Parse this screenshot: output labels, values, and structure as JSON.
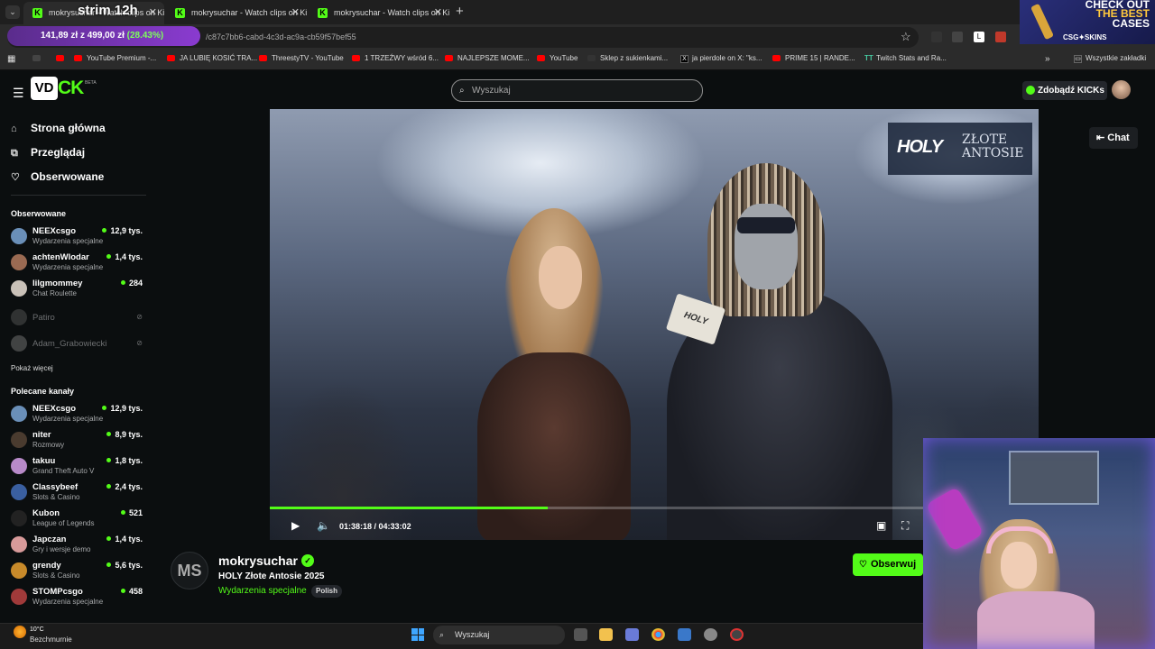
{
  "browser": {
    "tabs": [
      {
        "label": "mokrysuchar - Watch clips on Kick",
        "active": true
      },
      {
        "label": "mokrysuchar - Watch clips on Kick",
        "active": false
      },
      {
        "label": "mokrysuchar - Watch clips on Kick",
        "active": false
      }
    ],
    "url_tail": "/c87c7bb6-cabd-4c3d-ac9a-cb59f57bef55",
    "overlay_text": "strim 12h",
    "price_pill": {
      "price": "141,89 zł",
      "target": "z 499,00 zł",
      "pct": "(28.43%)"
    },
    "bookmarks": [
      {
        "label": "YouTube Premium -...",
        "icon": "youtube-icon"
      },
      {
        "label": "JA LUBIĘ KOSIĆ TRA...",
        "icon": "youtube-icon"
      },
      {
        "label": "ThreestyTV - YouTube",
        "icon": "youtube-icon"
      },
      {
        "label": "1 TRZEŹWY wśród 6...",
        "icon": "youtube-icon"
      },
      {
        "label": "NAJLEPSZE MOME...",
        "icon": "youtube-icon"
      },
      {
        "label": "YouTube",
        "icon": "youtube-icon"
      },
      {
        "label": "Sklep z sukienkami...",
        "icon": "shop-icon"
      },
      {
        "label": "ja pierdole on X: \"ks...",
        "icon": "x-icon"
      },
      {
        "label": "PRIME 15 | RANDE...",
        "icon": "youtube-icon"
      },
      {
        "label": "Twitch Stats and Ra...",
        "icon": "tt-icon"
      }
    ],
    "all_bookmarks": "Wszystkie zakładki"
  },
  "ad": {
    "line1": "CHECK OUT",
    "line2": "THE BEST",
    "line3": "CASES",
    "brand": "CSG✦SKINS"
  },
  "header": {
    "logo_box": "VD",
    "logo_text": "CK",
    "logo_beta": "BETA",
    "search_placeholder": "Wyszukaj",
    "kicks_button": "Zdobądź KICKs"
  },
  "sidebar": {
    "nav": [
      {
        "label": "Strona główna",
        "icon": "home-icon"
      },
      {
        "label": "Przeglądaj",
        "icon": "browse-icon"
      },
      {
        "label": "Obserwowane",
        "icon": "heart-icon"
      }
    ],
    "followed_title": "Obserwowane",
    "followed": [
      {
        "name": "NEEXcsgo",
        "category": "Wydarzenia specjalne",
        "viewers": "12,9 tys.",
        "color": "#6a8fb8"
      },
      {
        "name": "achtenWlodar",
        "category": "Wydarzenia specjalne",
        "viewers": "1,4 tys.",
        "color": "#9a6a52"
      },
      {
        "name": "lilgmommey",
        "category": "Chat Roulette",
        "viewers": "284",
        "color": "#c9c1b8"
      }
    ],
    "offline": [
      {
        "name": "Patiro",
        "color": "#555"
      },
      {
        "name": "Adam_Grabowiecki",
        "color": "#777"
      }
    ],
    "show_more": "Pokaż więcej",
    "recommended_title": "Polecane kanały",
    "recommended": [
      {
        "name": "NEEXcsgo",
        "category": "Wydarzenia specjalne",
        "viewers": "12,9 tys.",
        "color": "#6a8fb8"
      },
      {
        "name": "niter",
        "category": "Rozmowy",
        "viewers": "8,9 tys.",
        "color": "#4a3b2f"
      },
      {
        "name": "takuu",
        "category": "Grand Theft Auto V",
        "viewers": "1,8 tys.",
        "color": "#b88ac9"
      },
      {
        "name": "Classybeef",
        "category": "Slots & Casino",
        "viewers": "2,4 tys.",
        "color": "#3a5fa0"
      },
      {
        "name": "Kubon",
        "category": "League of Legends",
        "viewers": "521",
        "color": "#222"
      },
      {
        "name": "Japczan",
        "category": "Gry i wersje demo",
        "viewers": "1,4 tys.",
        "color": "#d89a9a"
      },
      {
        "name": "grendy",
        "category": "Slots & Casino",
        "viewers": "5,6 tys.",
        "color": "#c88a2a"
      },
      {
        "name": "STOMPcsgo",
        "category": "Wydarzenia specjalne",
        "viewers": "458",
        "color": "#a03a3a"
      }
    ]
  },
  "player": {
    "overlay_brand": "HOLY",
    "overlay_event": "ZŁOTE ANTOSIE",
    "mic_label": "HOLY",
    "time_current": "01:38:18",
    "time_total": "04:33:02",
    "progress": 0.426,
    "accent": "#53fc18"
  },
  "chat_button": "Chat",
  "channel": {
    "avatar_initials": "MS",
    "name": "mokrysuchar",
    "title": "HOLY Złote Antosie 2025",
    "category": "Wydarzenia specjalne",
    "tag": "Polish",
    "follow_label": "Obserwuj"
  },
  "taskbar": {
    "temperature": "10°C",
    "weather": "Bezchmurnie",
    "search_placeholder": "Wyszukaj"
  }
}
